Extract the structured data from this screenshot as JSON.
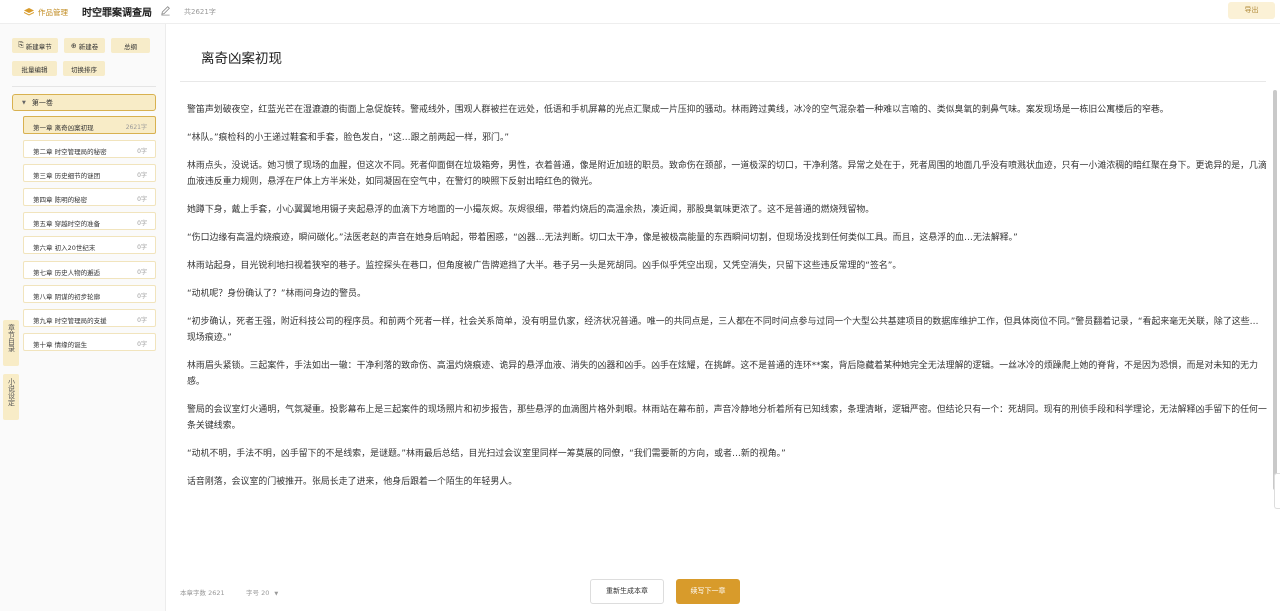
{
  "header": {
    "brand": "作品管理",
    "book_title": "时空罪案调查局",
    "word_total": "共2621字",
    "export_label": "导出"
  },
  "toolbar": {
    "new_chapter": "新建章节",
    "new_volume": "新建卷",
    "outline": "总纲",
    "batch_edit": "批量编辑",
    "switch_sort": "切换排序"
  },
  "volume": {
    "label": "第一卷"
  },
  "chapters": [
    {
      "title": "第一章 离奇凶案初现",
      "words": "2621字"
    },
    {
      "title": "第二章 时空管理局的秘密",
      "words": "0字"
    },
    {
      "title": "第三章 历史细节的谜团",
      "words": "0字"
    },
    {
      "title": "第四章 陈明的秘密",
      "words": "0字"
    },
    {
      "title": "第五章 穿越时空的准备",
      "words": "0字"
    },
    {
      "title": "第六章 初入20世纪末",
      "words": "0字"
    },
    {
      "title": "第七章 历史人物的邂逅",
      "words": "0字"
    },
    {
      "title": "第八章 阴谋的初步轮廓",
      "words": "0字"
    },
    {
      "title": "第九章 时空管理局的支援",
      "words": "0字"
    },
    {
      "title": "第十章 情缘的诞生",
      "words": "0字"
    }
  ],
  "side_tabs": {
    "catalog": "章节目录",
    "settings": "小说设定"
  },
  "editor": {
    "chapter_title": "离奇凶案初现",
    "paragraphs": [
      "警笛声划破夜空，红蓝光芒在湿漉漉的街面上急促旋转。警戒线外，围观人群被拦在远处，低语和手机屏幕的光点汇聚成一片压抑的骚动。林雨跨过黄线，冰冷的空气混杂着一种难以言喻的、类似臭氧的刺鼻气味。案发现场是一栋旧公寓楼后的窄巷。",
      "“林队。”痕检科的小王递过鞋套和手套，脸色发白，“这…跟之前两起一样，邪门。”",
      "林雨点头，没说话。她习惯了现场的血腥，但这次不同。死者仰面倒在垃圾箱旁，男性，衣着普通，像是附近加班的职员。致命伤在颈部，一道极深的切口，干净利落。异常之处在于，死者周围的地面几乎没有喷溅状血迹，只有一小滩浓稠的暗红聚在身下。更诡异的是，几滴血液违反重力规则，悬浮在尸体上方半米处，如同凝固在空气中，在警灯的映照下反射出暗红色的微光。",
      "她蹲下身，戴上手套，小心翼翼地用镊子夹起悬浮的血滴下方地面的一小撮灰烬。灰烬很细，带着灼烧后的高温余热，凑近闻，那股臭氧味更浓了。这不是普通的燃烧残留物。",
      "“伤口边缘有高温灼烧痕迹，瞬间碳化。”法医老赵的声音在她身后响起，带着困惑，“凶器…无法判断。切口太干净，像是被极高能量的东西瞬间切割，但现场没找到任何类似工具。而且，这悬浮的血…无法解释。”",
      "林雨站起身，目光锐利地扫视着狭窄的巷子。监控探头在巷口，但角度被广告牌遮挡了大半。巷子另一头是死胡同。凶手似乎凭空出现，又凭空消失，只留下这些违反常理的“签名”。",
      "“动机呢？身份确认了？”林雨问身边的警员。",
      "“初步确认，死者王强，附近科技公司的程序员。和前两个死者一样，社会关系简单，没有明显仇家，经济状况普通。唯一的共同点是，三人都在不同时间点参与过同一个大型公共基建项目的数据库维护工作，但具体岗位不同。”警员翻着记录，“看起来毫无关联，除了这些…现场痕迹。”",
      "林雨眉头紧锁。三起案件，手法如出一辙：干净利落的致命伤、高温灼烧痕迹、诡异的悬浮血液、消失的凶器和凶手。凶手在炫耀，在挑衅。这不是普通的连环**案，背后隐藏着某种她完全无法理解的逻辑。一丝冰冷的烦躁爬上她的脊背，不是因为恐惧，而是对未知的无力感。",
      "警局的会议室灯火通明，气氛凝重。投影幕布上是三起案件的现场照片和初步报告，那些悬浮的血滴图片格外刺眼。林雨站在幕布前，声音冷静地分析着所有已知线索，条理清晰，逻辑严密。但结论只有一个：死胡同。现有的刑侦手段和科学理论，无法解释凶手留下的任何一条关键线索。",
      "“动机不明，手法不明，凶手留下的不是线索，是谜题。”林雨最后总结，目光扫过会议室里同样一筹莫展的同僚，“我们需要新的方向，或者…新的视角。”",
      "话音刚落，会议室的门被推开。张局长走了进来，他身后跟着一个陌生的年轻男人。"
    ],
    "chapter_words": "本章字数 2621",
    "font_size": "字号 20",
    "regenerate_label": "重新生成本章",
    "continue_label": "续写下一章"
  },
  "colors": {
    "accent": "#d89b2b",
    "accent_light": "#f8ecc7",
    "border_accent": "#d8b150"
  }
}
